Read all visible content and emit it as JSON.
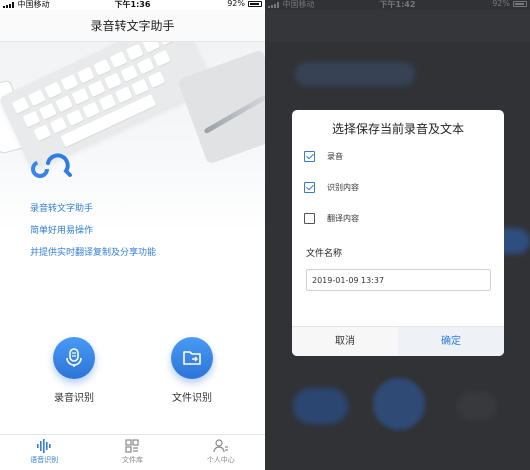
{
  "left": {
    "status": {
      "carrier": "中国移动",
      "time": "下午1:36",
      "battery": "92%"
    },
    "title": "录音转文字助手",
    "features": [
      "录音转文字助手",
      "简单好用易操作",
      "并提供实时翻译复制及分享功能"
    ],
    "actions": {
      "record_label": "录音识别",
      "file_label": "文件识别"
    },
    "tabs": [
      {
        "label": "语音识别",
        "active": true
      },
      {
        "label": "文件库",
        "active": false
      },
      {
        "label": "个人中心",
        "active": false
      }
    ]
  },
  "right": {
    "status": {
      "carrier": "中国移动",
      "time": "下午1:42",
      "battery": "92%"
    },
    "dialog": {
      "title": "选择保存当前录音及文本",
      "options": [
        {
          "label": "录音",
          "checked": true
        },
        {
          "label": "识别内容",
          "checked": true
        },
        {
          "label": "翻译内容",
          "checked": false
        }
      ],
      "name_label": "文件名称",
      "name_value": "2019-01-09 13:37",
      "cancel_label": "取消",
      "ok_label": "确定"
    }
  },
  "colors": {
    "accent": "#2f7de1",
    "overlay": "#303236"
  }
}
